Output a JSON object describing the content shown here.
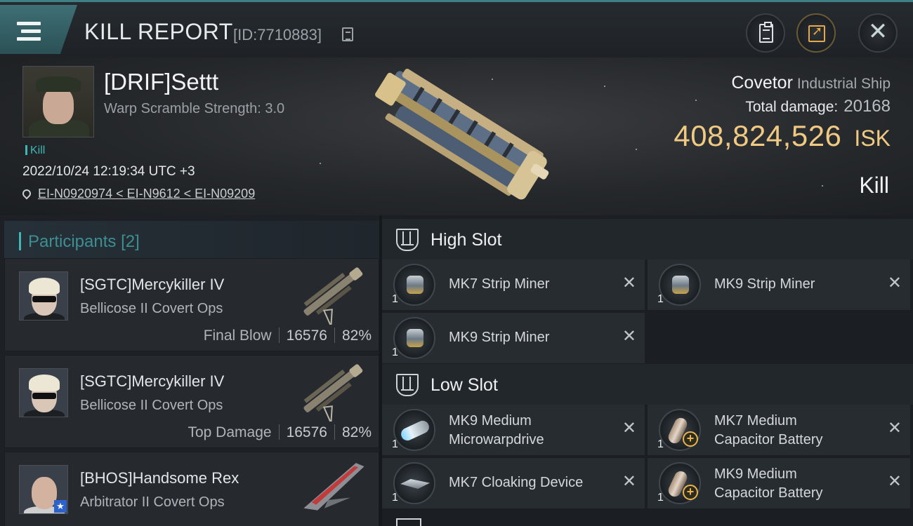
{
  "header": {
    "title": "KILL REPORT",
    "report_id": "[ID:7710883]"
  },
  "victim": {
    "name": "[DRIF]Settt",
    "warp_scramble": "Warp Scramble Strength: 3.0",
    "tag": "Kill",
    "timestamp": "2022/10/24 12:19:34 UTC +3",
    "location": "EI-N0920974 < EI-N9612 < EI-N09209"
  },
  "ship": {
    "name": "Covetor",
    "class": "Industrial Ship",
    "total_damage_label": "Total damage:",
    "total_damage": "20168",
    "isk_value": "408,824,526",
    "isk_unit": "ISK",
    "outcome": "Kill"
  },
  "participants": {
    "label": "Participants",
    "count": "[2]",
    "list": [
      {
        "name": "[SGTC]Mercykiller IV",
        "ship": "Bellicose II Covert Ops",
        "role": "Final Blow",
        "damage": "16576",
        "percent": "82%"
      },
      {
        "name": "[SGTC]Mercykiller IV",
        "ship": "Bellicose II Covert Ops",
        "role": "Top Damage",
        "damage": "16576",
        "percent": "82%"
      },
      {
        "name": "[BHOS]Handsome Rex",
        "ship": "Arbitrator II Covert Ops",
        "role": "",
        "damage": "",
        "percent": ""
      }
    ]
  },
  "high_slot": {
    "title": "High Slot",
    "modules": [
      {
        "name": "MK7 Strip Miner",
        "qty": "1"
      },
      {
        "name": "MK9 Strip Miner",
        "qty": "1"
      },
      {
        "name": "MK9 Strip Miner",
        "qty": "1"
      }
    ]
  },
  "low_slot": {
    "title": "Low Slot",
    "modules": [
      {
        "line1": "MK9 Medium",
        "line2": "Microwarpdrive",
        "qty": "1"
      },
      {
        "line1": "MK7 Medium",
        "line2": "Capacitor Battery",
        "qty": "1"
      },
      {
        "name": "MK7 Cloaking Device",
        "qty": "1"
      },
      {
        "line1": "MK9 Medium",
        "line2": "Capacitor Battery",
        "qty": "1"
      }
    ]
  },
  "close_glyph": "✕",
  "colors": {
    "accent": "#3fb7b4",
    "isk_gold": "#f0c983",
    "brand_teal": "#3e6f74"
  },
  "icons": [
    "menu-icon",
    "copy-icon",
    "clipboard-icon",
    "share-icon",
    "close-icon",
    "location-pin-icon",
    "slot-icon"
  ]
}
